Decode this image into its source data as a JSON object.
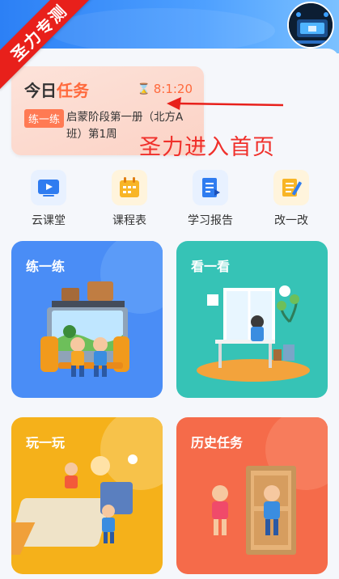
{
  "watermark": {
    "text": "圣力专测"
  },
  "task_card": {
    "title_accent": "今日",
    "title_rest": "任务",
    "timer": "8:1:20",
    "tag": "练一练",
    "description": "启蒙阶段第一册（北方A班）第1周"
  },
  "annotation": {
    "text": "圣力进入首页"
  },
  "quick_nav": [
    {
      "label": "云课堂",
      "icon": "video-icon"
    },
    {
      "label": "课程表",
      "icon": "calendar-icon"
    },
    {
      "label": "学习报告",
      "icon": "report-icon"
    },
    {
      "label": "改一改",
      "icon": "edit-notes-icon"
    }
  ],
  "tiles": [
    {
      "title": "练一练",
      "color": "#4a8df6"
    },
    {
      "title": "看一看",
      "color": "#36c3b6"
    },
    {
      "title": "玩一玩",
      "color": "#f5b11a"
    },
    {
      "title": "历史任务",
      "color": "#f56b4a"
    }
  ]
}
